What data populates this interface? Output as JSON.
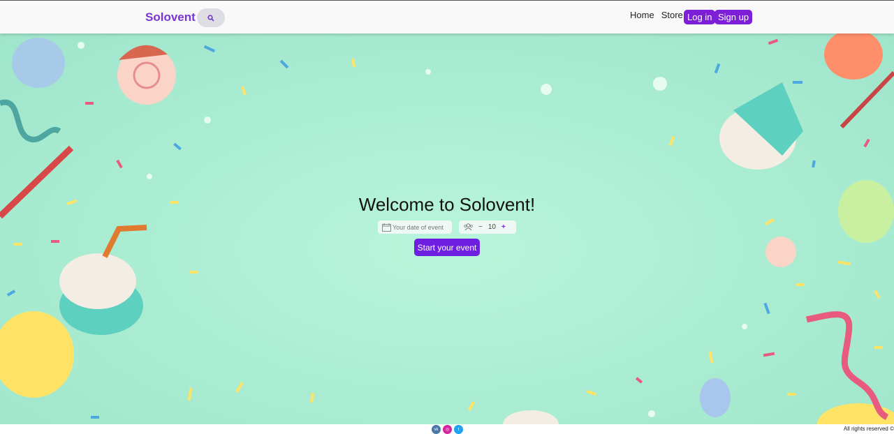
{
  "nav": {
    "brand": "Solovent",
    "search_icon": "search-icon",
    "home": "Home",
    "store": "Store",
    "login": "Log in",
    "signup": "Sign up"
  },
  "hero": {
    "title": "Welcome to Solovent!",
    "date_placeholder": "Your date of event",
    "calendar_icon": "calendar-icon",
    "guests_icon": "people-icon",
    "guests_value": "10",
    "minus": "−",
    "plus": "+",
    "start_button": "Start your event"
  },
  "footer": {
    "socials": [
      "vk-icon",
      "instagram-icon",
      "twitter-icon"
    ],
    "copyright": "All rights reserved ©"
  },
  "colors": {
    "brand": "#7b35d6",
    "button": "#7d1fd9",
    "background": "#b3f0d6"
  }
}
